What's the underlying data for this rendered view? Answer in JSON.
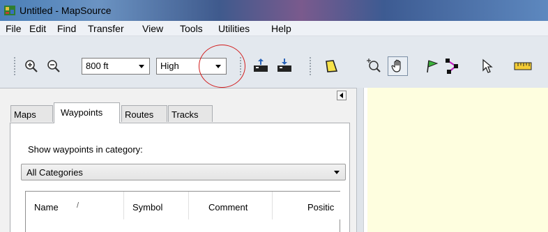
{
  "window": {
    "title": "Untitled - MapSource"
  },
  "menu": [
    "File",
    "Edit",
    "Find",
    "Transfer",
    "View",
    "Tools",
    "Utilities",
    "Help"
  ],
  "toolbar": {
    "zoom_value": "800 ft",
    "detail_value": "High",
    "icons": [
      "zoom-in-icon",
      "zoom-out-icon",
      "receive-from-device-icon",
      "send-to-device-icon",
      "map-selection-icon",
      "zoom-tool-icon",
      "hand-tool-icon",
      "waypoint-tool-icon",
      "route-tool-icon",
      "selection-tool-icon",
      "measure-tool-icon"
    ]
  },
  "panel": {
    "tabs": [
      "Maps",
      "Waypoints",
      "Routes",
      "Tracks"
    ],
    "active_tab": "Waypoints",
    "category_label": "Show waypoints in category:",
    "category_value": "All Categories",
    "columns": [
      "Name",
      "Symbol",
      "Comment",
      "Positic"
    ],
    "sort_indicator": "/"
  },
  "colors": {
    "annotation": "#d21c1c",
    "map_background": "#fefedf"
  }
}
